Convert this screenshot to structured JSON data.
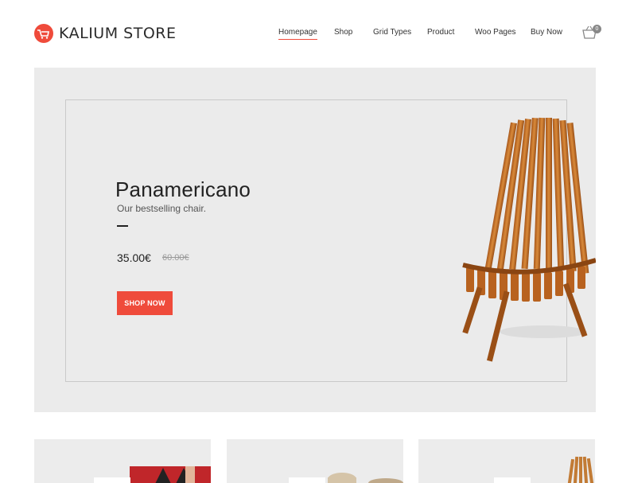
{
  "header": {
    "logo_text": "KALIUM STORE",
    "logo_icon": "shopping-cart-icon",
    "nav": [
      {
        "label": "Homepage",
        "active": true
      },
      {
        "label": "Shop",
        "active": false
      },
      {
        "label": "Grid Types",
        "active": false
      },
      {
        "label": "Product",
        "active": false
      },
      {
        "label": "Woo Pages",
        "active": false
      },
      {
        "label": "Buy Now",
        "active": false
      }
    ],
    "cart": {
      "icon": "basket-icon",
      "count": "0"
    }
  },
  "hero": {
    "title": "Panamericano",
    "subtitle": "Our bestselling chair.",
    "price": "35.00€",
    "old_price": "60.00€",
    "button_label": "SHOP NOW"
  },
  "colors": {
    "accent": "#ef4b3b",
    "hero_bg": "#ebebeb",
    "card_bg": "#ececec"
  }
}
